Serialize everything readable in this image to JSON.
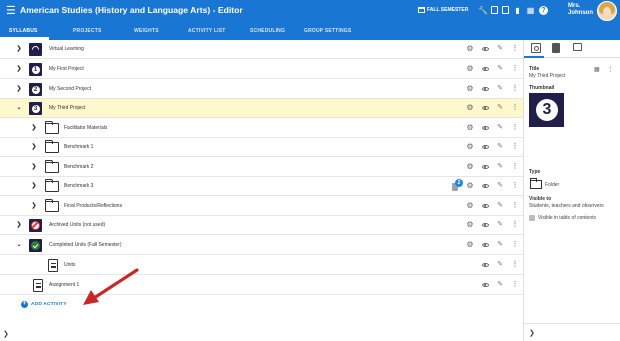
{
  "header": {
    "menu_icon": "menu-icon",
    "title": "American Studies (History and Language Arts) - Editor",
    "semester": "FALL SEMESTER",
    "icons": [
      "wrench-icon",
      "document-icon",
      "folder-icon",
      "comment-icon",
      "grid-icon",
      "help-icon"
    ],
    "user_name_line1": "Mrs.",
    "user_name_line2": "Johnson"
  },
  "tabs": [
    {
      "label": "SYLLABUS",
      "active": true
    },
    {
      "label": "PROJECTS",
      "active": false
    },
    {
      "label": "WEIGHTS",
      "active": false
    },
    {
      "label": "ACTIVITY LIST",
      "active": false
    },
    {
      "label": "SCHEDULING",
      "active": false
    },
    {
      "label": "GROUP SETTINGS",
      "active": false
    }
  ],
  "syllabus": {
    "rows": [
      {
        "label": "Virtual Learning",
        "expand": "collapsed",
        "icon": "wifi-icon"
      },
      {
        "label": "My First Project",
        "expand": "collapsed",
        "icon": "number-1-icon",
        "number": "1"
      },
      {
        "label": "My Second Project",
        "expand": "collapsed",
        "icon": "number-2-icon",
        "number": "2"
      },
      {
        "label": "My Third Project",
        "expand": "expanded",
        "icon": "number-3-icon",
        "number": "3",
        "highlighted": true
      },
      {
        "label": "Facilitator Materials",
        "expand": "collapsed",
        "icon": "folder-icon"
      },
      {
        "label": "Benchmark 1",
        "expand": "collapsed",
        "icon": "folder-icon"
      },
      {
        "label": "Benchmark 2",
        "expand": "collapsed",
        "icon": "folder-icon"
      },
      {
        "label": "Benchmark 3",
        "expand": "collapsed",
        "icon": "folder-icon",
        "badge": "2"
      },
      {
        "label": "Final Products/Reflections",
        "expand": "collapsed",
        "icon": "folder-icon"
      },
      {
        "label": "Archived Units (not used)",
        "expand": "collapsed",
        "icon": "no-entry-icon"
      },
      {
        "label": "Completed Units (Fall Semester)",
        "expand": "expanded",
        "icon": "check-icon"
      },
      {
        "label": "Units",
        "icon": "document-icon"
      },
      {
        "label": "Assignment 1",
        "icon": "document-icon"
      }
    ],
    "add_activity_label": "ADD ACTIVITY"
  },
  "details_panel": {
    "tabs": [
      "settings-icon",
      "document-icon",
      "pages-icon"
    ],
    "title_label": "Title",
    "title_value": "My Third Project",
    "thumbnail_label": "Thumbnail",
    "thumbnail_number": "3",
    "type_label": "Type",
    "type_value": "Folder",
    "visible_label": "Visible to",
    "visible_value": "Students, teachers and observers",
    "toc_label": "Visible in table of contents"
  },
  "colors": {
    "primary": "#1976d2",
    "highlight_row": "#fff8cd",
    "thumb_bg": "#1f1f4a",
    "arrow": "#c62828"
  }
}
